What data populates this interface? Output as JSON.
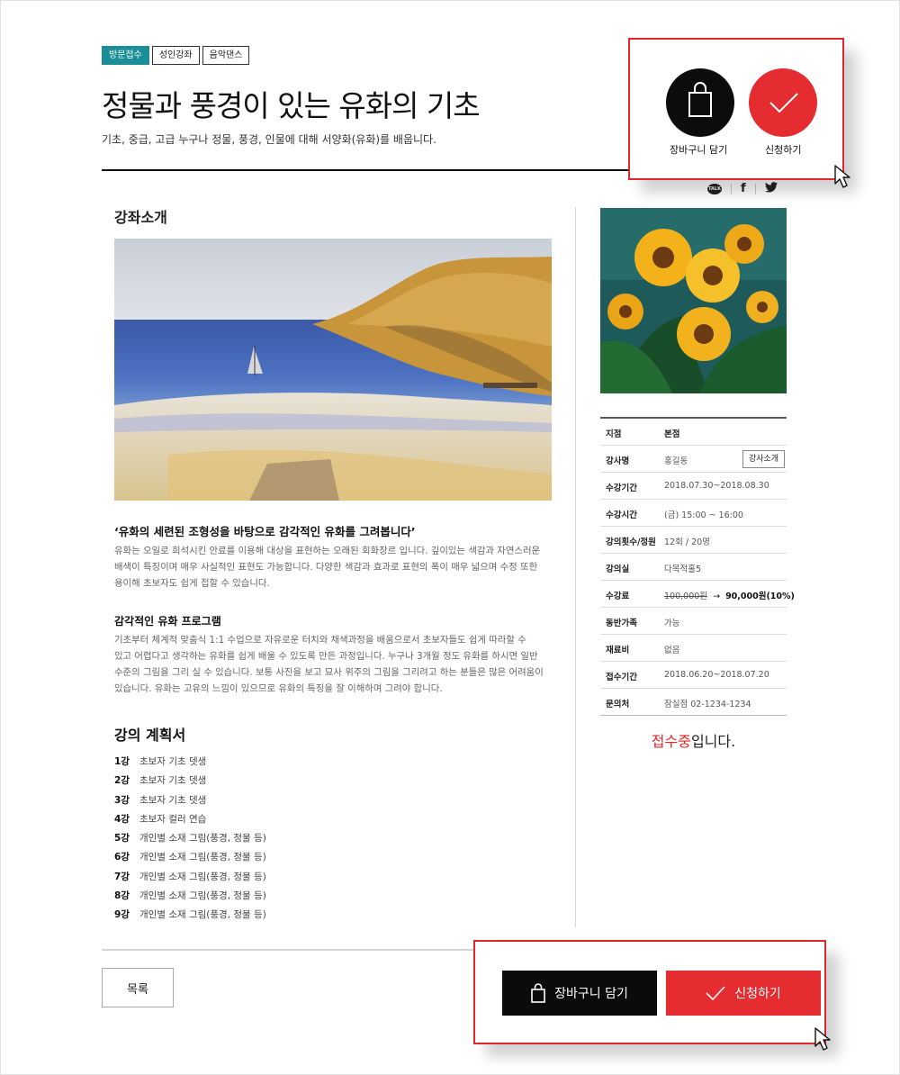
{
  "tags": [
    "방문접수",
    "성인강좌",
    "음악댄스"
  ],
  "course": {
    "title": "정물과 풍경이 있는 유화의 기초",
    "subtitle": "기초, 중급, 고급 누구나 정물, 풍경, 인물에 대해 서양화(유화)를 배웁니다."
  },
  "share": {
    "talk_label": "TALK",
    "facebook_label": "f",
    "twitter_label": "🐦"
  },
  "callout_top": {
    "cart_label": "장바구니 담기",
    "apply_label": "신청하기"
  },
  "intro": {
    "heading": "강좌소개",
    "headline": "‘유화의 세련된 조형성을 바탕으로 감각적인 유화를 그려봅니다’",
    "para1": [
      "유화는 오일로 희석시킨 안료를 이용해 대상을 표현하는 오래된 회화장르 입니다. 깊이있는 색감과 자연스러운",
      "배색이 특징이며 매우 사실적인 표현도 가능합니다. 다양한 색감과 효과로 표현의 폭이 매우 넓으며 수정 또한",
      "용이해 초보자도 쉽게 접할 수 있습니다."
    ],
    "program_heading": "감각적인 유화 프로그램",
    "para2": [
      "기초부터 체계적 맞춤식 1:1 수업으로 자유로운 터치와 채색과정을 배움으로서 초보자들도 쉽게 따라할 수",
      "있고 어렵다고 생각하는 유화를 쉽게 배울 수 있도록 만든 과정입니다. 누구나 3개월 정도 유화를 하시면 일반",
      "수준의 그림을 그리 실 수 있습니다. 보통 사진을 보고 묘사 위주의 그림을 그리려고 하는 분들은 많은 어려움이",
      "있습니다. 유화는 고유의 느낌이 있으므로 유화의 특징을 잘 이해하며 그려야 합니다."
    ]
  },
  "plan": {
    "heading": "강의 계획서",
    "items": [
      {
        "num": "1강",
        "text": "초보자 기초 뎃생"
      },
      {
        "num": "2강",
        "text": "초보자 기초 뎃생"
      },
      {
        "num": "3강",
        "text": "초보자 기초 뎃생"
      },
      {
        "num": "4강",
        "text": "초보자 컬러 연습"
      },
      {
        "num": "5강",
        "text": "개인별 소재 그림(풍경, 정물 등)"
      },
      {
        "num": "6강",
        "text": "개인별 소재 그림(풍경, 정물 등)"
      },
      {
        "num": "7강",
        "text": "개인별 소재 그림(풍경, 정물 등)"
      },
      {
        "num": "8강",
        "text": "개인별 소재 그림(풍경, 정물 등)"
      },
      {
        "num": "9강",
        "text": "개인별 소재 그림(풍경, 정물 등)"
      }
    ]
  },
  "info": {
    "branch": {
      "k": "지점",
      "v": "본점"
    },
    "instructor": {
      "k": "강사명",
      "v": "홍길동",
      "button": "강사소개"
    },
    "period": {
      "k": "수강기간",
      "v": "2018.07.30~2018.08.30"
    },
    "time": {
      "k": "수강시간",
      "v": "(금) 15:00 ~ 16:00"
    },
    "sessions": {
      "k": "강의횟수/정원",
      "v": "12회 / 20명"
    },
    "room": {
      "k": "강의실",
      "v": "다목적홀5"
    },
    "fee": {
      "k": "수강료",
      "old": "100,000원",
      "arrow": "→",
      "new": "90,000원(10%)"
    },
    "companion": {
      "k": "동반가족",
      "v": "가능"
    },
    "material": {
      "k": "재료비",
      "v": "없음"
    },
    "reg_period": {
      "k": "접수기간",
      "v": "2018.06.20~2018.07.20"
    },
    "contact": {
      "k": "문의처",
      "v": "잠실점 02-1234-1234"
    }
  },
  "status": {
    "highlight": "접수중",
    "rest": "입니다."
  },
  "bottom": {
    "list_label": "목록",
    "cart_label": "장바구니 담기",
    "apply_label": "신청하기"
  },
  "colors": {
    "accent": "#e42c31",
    "tag": "#1a8f97",
    "dark": "#0b0b0b"
  }
}
